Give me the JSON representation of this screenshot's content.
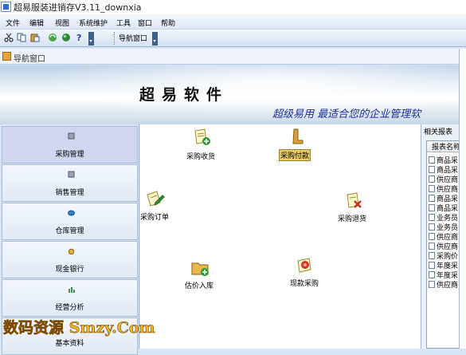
{
  "window": {
    "title": "超易服装进销存V3.11_downxia"
  },
  "menu": [
    "文件",
    "编辑",
    "视图",
    "系统维护",
    "工具",
    "窗口",
    "帮助"
  ],
  "toolbar": {
    "nav_button": "导航窗口"
  },
  "nav_window": {
    "title": "导航窗口"
  },
  "banner": {
    "title": "超易软件",
    "slogan": "超级易用 最适合您的企业管理软"
  },
  "sidebar": [
    {
      "label": "采购管理",
      "active": true
    },
    {
      "label": "销售管理",
      "active": false
    },
    {
      "label": "仓库管理",
      "active": false
    },
    {
      "label": "现金银行",
      "active": false
    },
    {
      "label": "经营分析",
      "active": false
    },
    {
      "label": "基本资料",
      "active": false
    }
  ],
  "main_items": [
    {
      "label": "采购收货",
      "icon": "doc-plus-icon"
    },
    {
      "label": "采购付款",
      "icon": "boot-icon",
      "selected": true
    },
    {
      "label": "采购订单",
      "icon": "doc-pencil-icon"
    },
    {
      "label": "采购退货",
      "icon": "doc-x-icon"
    },
    {
      "label": "估价入库",
      "icon": "folder-plus-icon"
    },
    {
      "label": "现款采购",
      "icon": "doc-stamp-icon"
    }
  ],
  "reports": {
    "panel_title": "相关报表",
    "column_header": "报表名称",
    "rows": [
      "商品采",
      "商品采",
      "供应商",
      "供应商",
      "商品采",
      "商品采",
      "业务员",
      "业务员",
      "供应商",
      "供应商",
      "采购价",
      "年度采",
      "年度采",
      "供应商"
    ]
  },
  "watermark": "数码资源 Smzy.Com"
}
